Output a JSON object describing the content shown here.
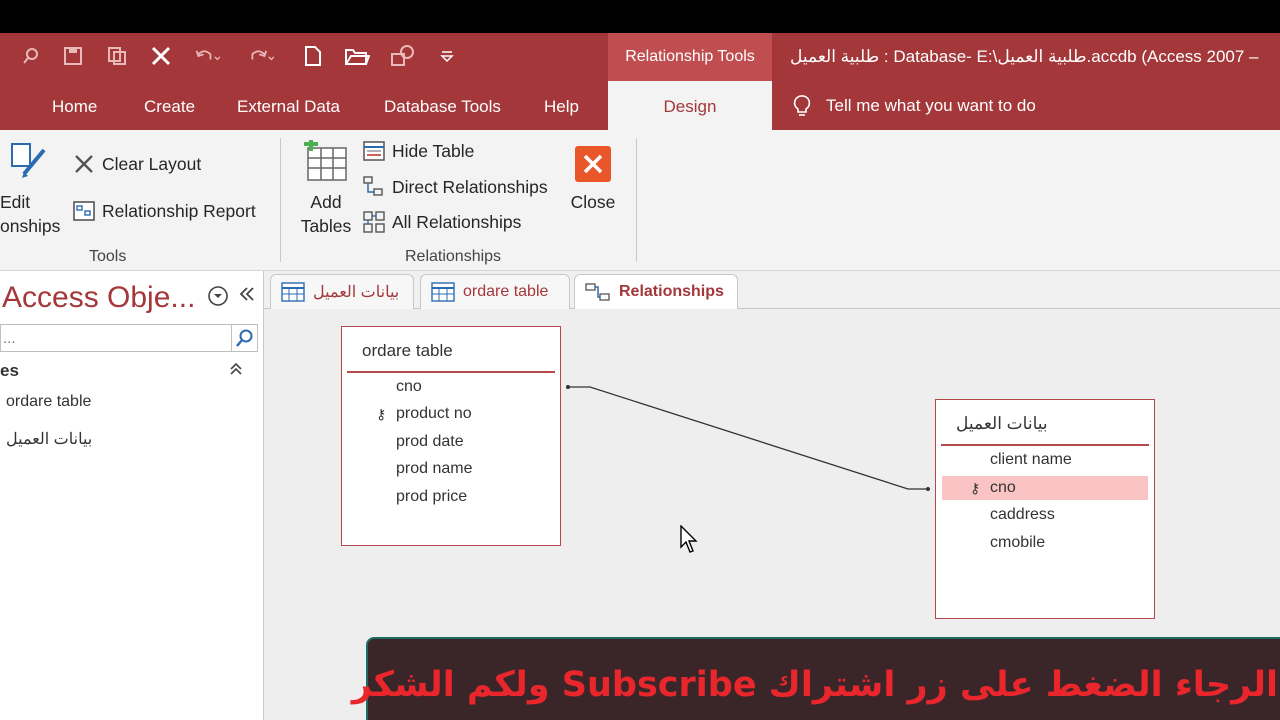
{
  "window": {
    "title": "طلبية العميل : Database- E:\\طلبية العميل.accdb (Access 2007 –",
    "context_tab_header": "Relationship Tools",
    "accent_color": "#a4373a"
  },
  "tabs": [
    {
      "label": "Home"
    },
    {
      "label": "Create"
    },
    {
      "label": "External Data"
    },
    {
      "label": "Database Tools"
    },
    {
      "label": "Help"
    },
    {
      "label": "Design"
    }
  ],
  "tell_me": "Tell me what you want to do",
  "ribbon": {
    "edit_line1": "Edit",
    "edit_line2": "onships",
    "clear_layout": "Clear Layout",
    "relationship_report": "Relationship Report",
    "tools_group": "Tools",
    "add_tables_line1": "Add",
    "add_tables_line2": "Tables",
    "hide_table": "Hide Table",
    "direct_relationships": "Direct Relationships",
    "all_relationships": "All Relationships",
    "relationships_group": "Relationships",
    "close": "Close"
  },
  "nav": {
    "title": "Access Obje...",
    "search_placeholder": "...",
    "section": "es",
    "items": [
      "ordare table",
      "بيانات العميل"
    ]
  },
  "doc_tabs": [
    {
      "label": "بيانات العميل"
    },
    {
      "label": "ordare table"
    },
    {
      "label": "Relationships"
    }
  ],
  "tables": [
    {
      "name": "ordare table",
      "fields": [
        {
          "name": "cno",
          "key": false
        },
        {
          "name": "product no",
          "key": true
        },
        {
          "name": "prod date",
          "key": false
        },
        {
          "name": "prod name",
          "key": false
        },
        {
          "name": "prod price",
          "key": false
        }
      ]
    },
    {
      "name": "بيانات العميل",
      "fields": [
        {
          "name": "client name",
          "key": false
        },
        {
          "name": "cno",
          "key": true,
          "selected": true
        },
        {
          "name": "caddress",
          "key": false
        },
        {
          "name": "cmobile",
          "key": false
        }
      ]
    }
  ],
  "banner": "الرجاء الضغط على زر اشتراك Subscribe ولكم الشكر"
}
